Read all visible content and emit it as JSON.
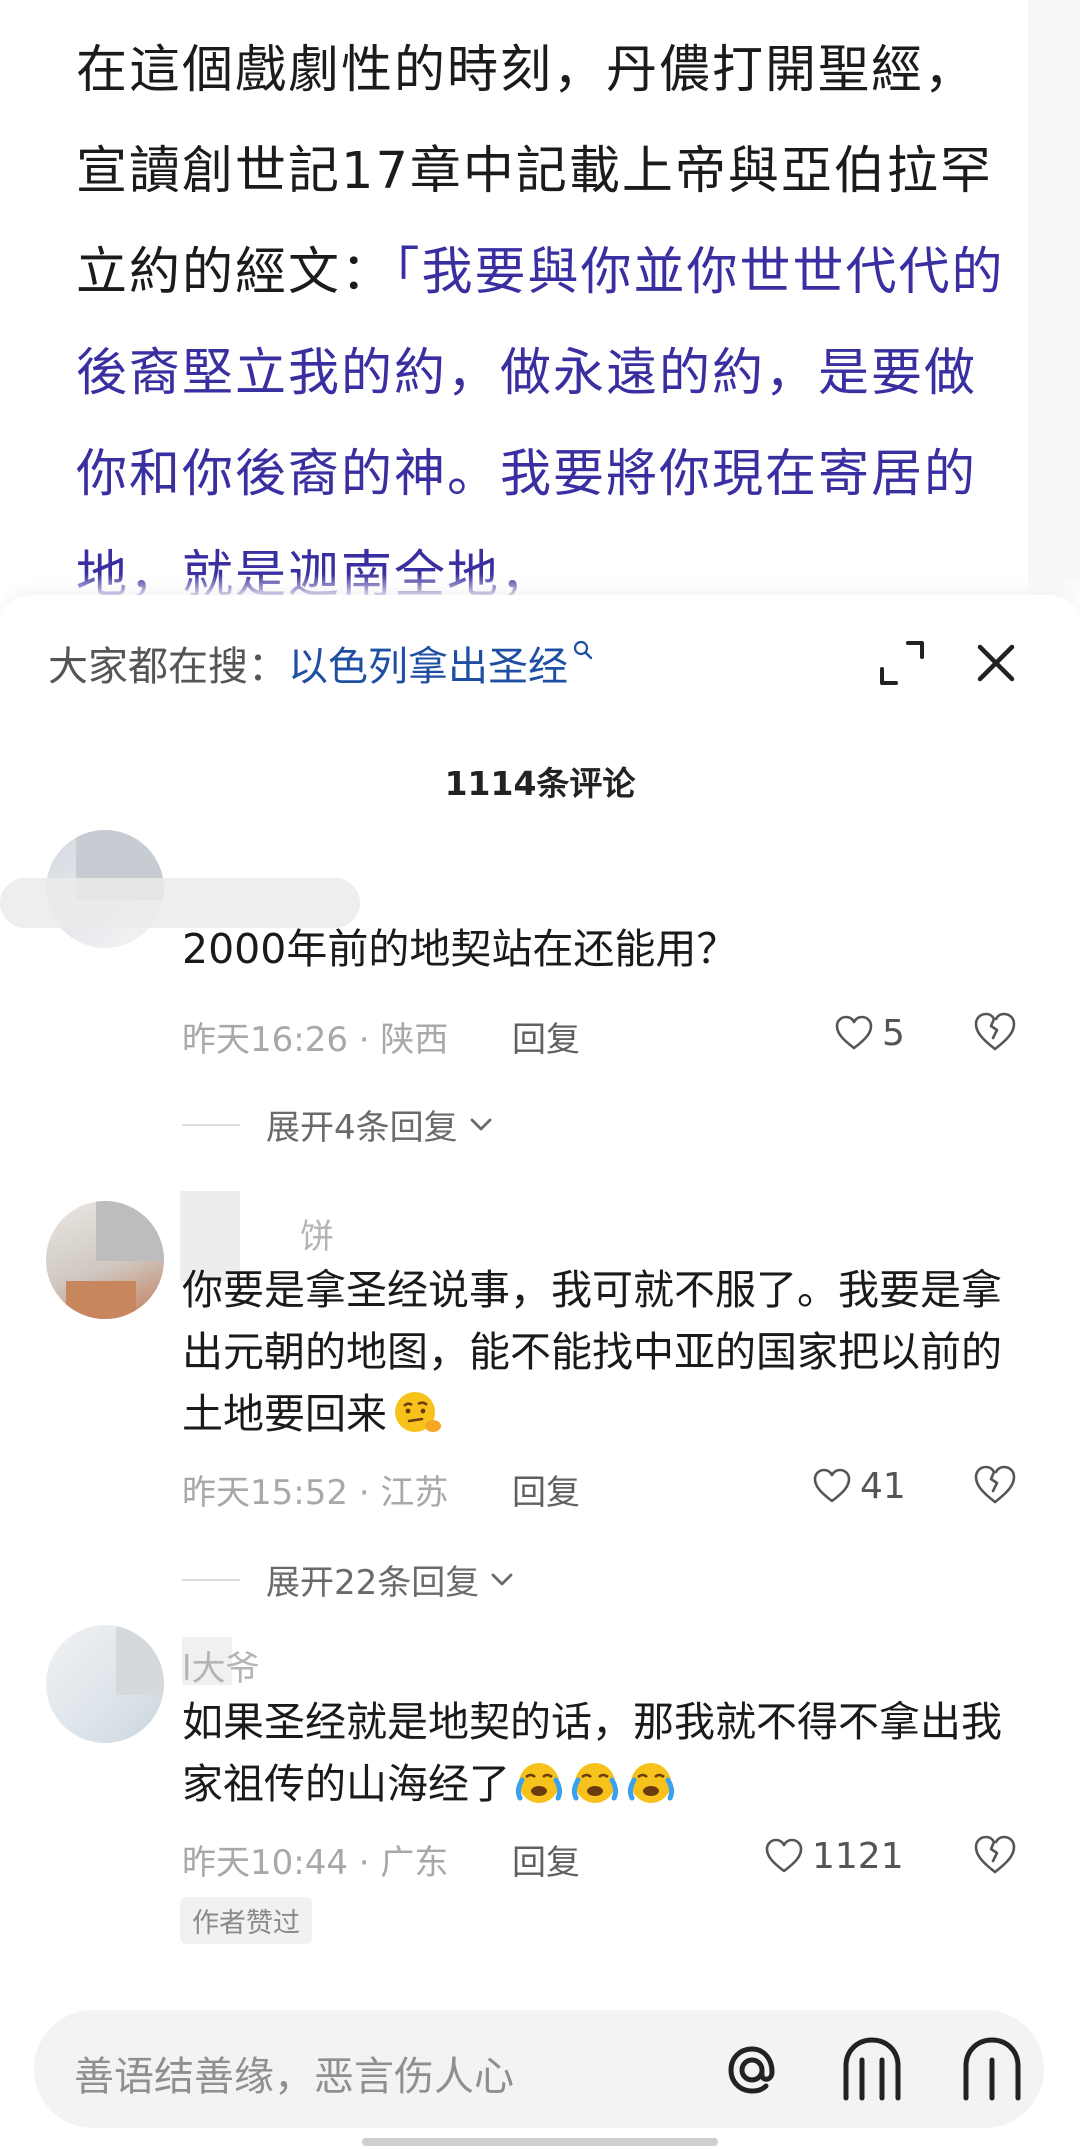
{
  "article": {
    "text_before": "在這個戲劇性的時刻，丹儂打開聖經，宣讀創世記17章中記載上帝與亞伯拉罕立約的經文：",
    "quote": "「我要與你並你世世代代的後裔堅立我的約，做永遠的約，是要做你和你後裔的神。我要將你現在寄居的地，就是迦南全地，"
  },
  "search": {
    "prefix": "大家都在搜：",
    "term": "以色列拿出圣经",
    "icon": "search-icon"
  },
  "comments_header": {
    "count_number": "1114",
    "count_suffix": "条评论"
  },
  "comments": [
    {
      "username": "",
      "text": "2000年前的地契站在还能用？",
      "time_location": "昨天16:26 · 陕西",
      "reply_label": "回复",
      "likes": "5",
      "expand_label": "展开4条回复",
      "author_liked": ""
    },
    {
      "username": "饼",
      "text": "你要是拿圣经说事，我可就不服了。我要是拿出元朝的地图，能不能找中亚的国家把以前的土地要回来",
      "time_location": "昨天15:52 · 江苏",
      "reply_label": "回复",
      "likes": "41",
      "expand_label": "展开22条回复",
      "emojis": [
        "thinking-face-icon"
      ]
    },
    {
      "username": "l大爷",
      "text": "如果圣经就是地契的话，那我就不得不拿出我家祖传的山海经了",
      "time_location": "昨天10:44 · 广东",
      "reply_label": "回复",
      "likes": "1121",
      "author_liked": "作者赞过",
      "emojis": [
        "crying-face-icon",
        "crying-face-icon",
        "crying-face-icon"
      ]
    }
  ],
  "input_bar": {
    "placeholder": "善语结善缘，恶言伤人心",
    "icons": [
      "at-icon",
      "emoji-icon",
      "image-icon"
    ]
  },
  "colors": {
    "quote": "#3a2fa0",
    "link": "#1f4fa3",
    "meta": "#a8a8a8"
  }
}
